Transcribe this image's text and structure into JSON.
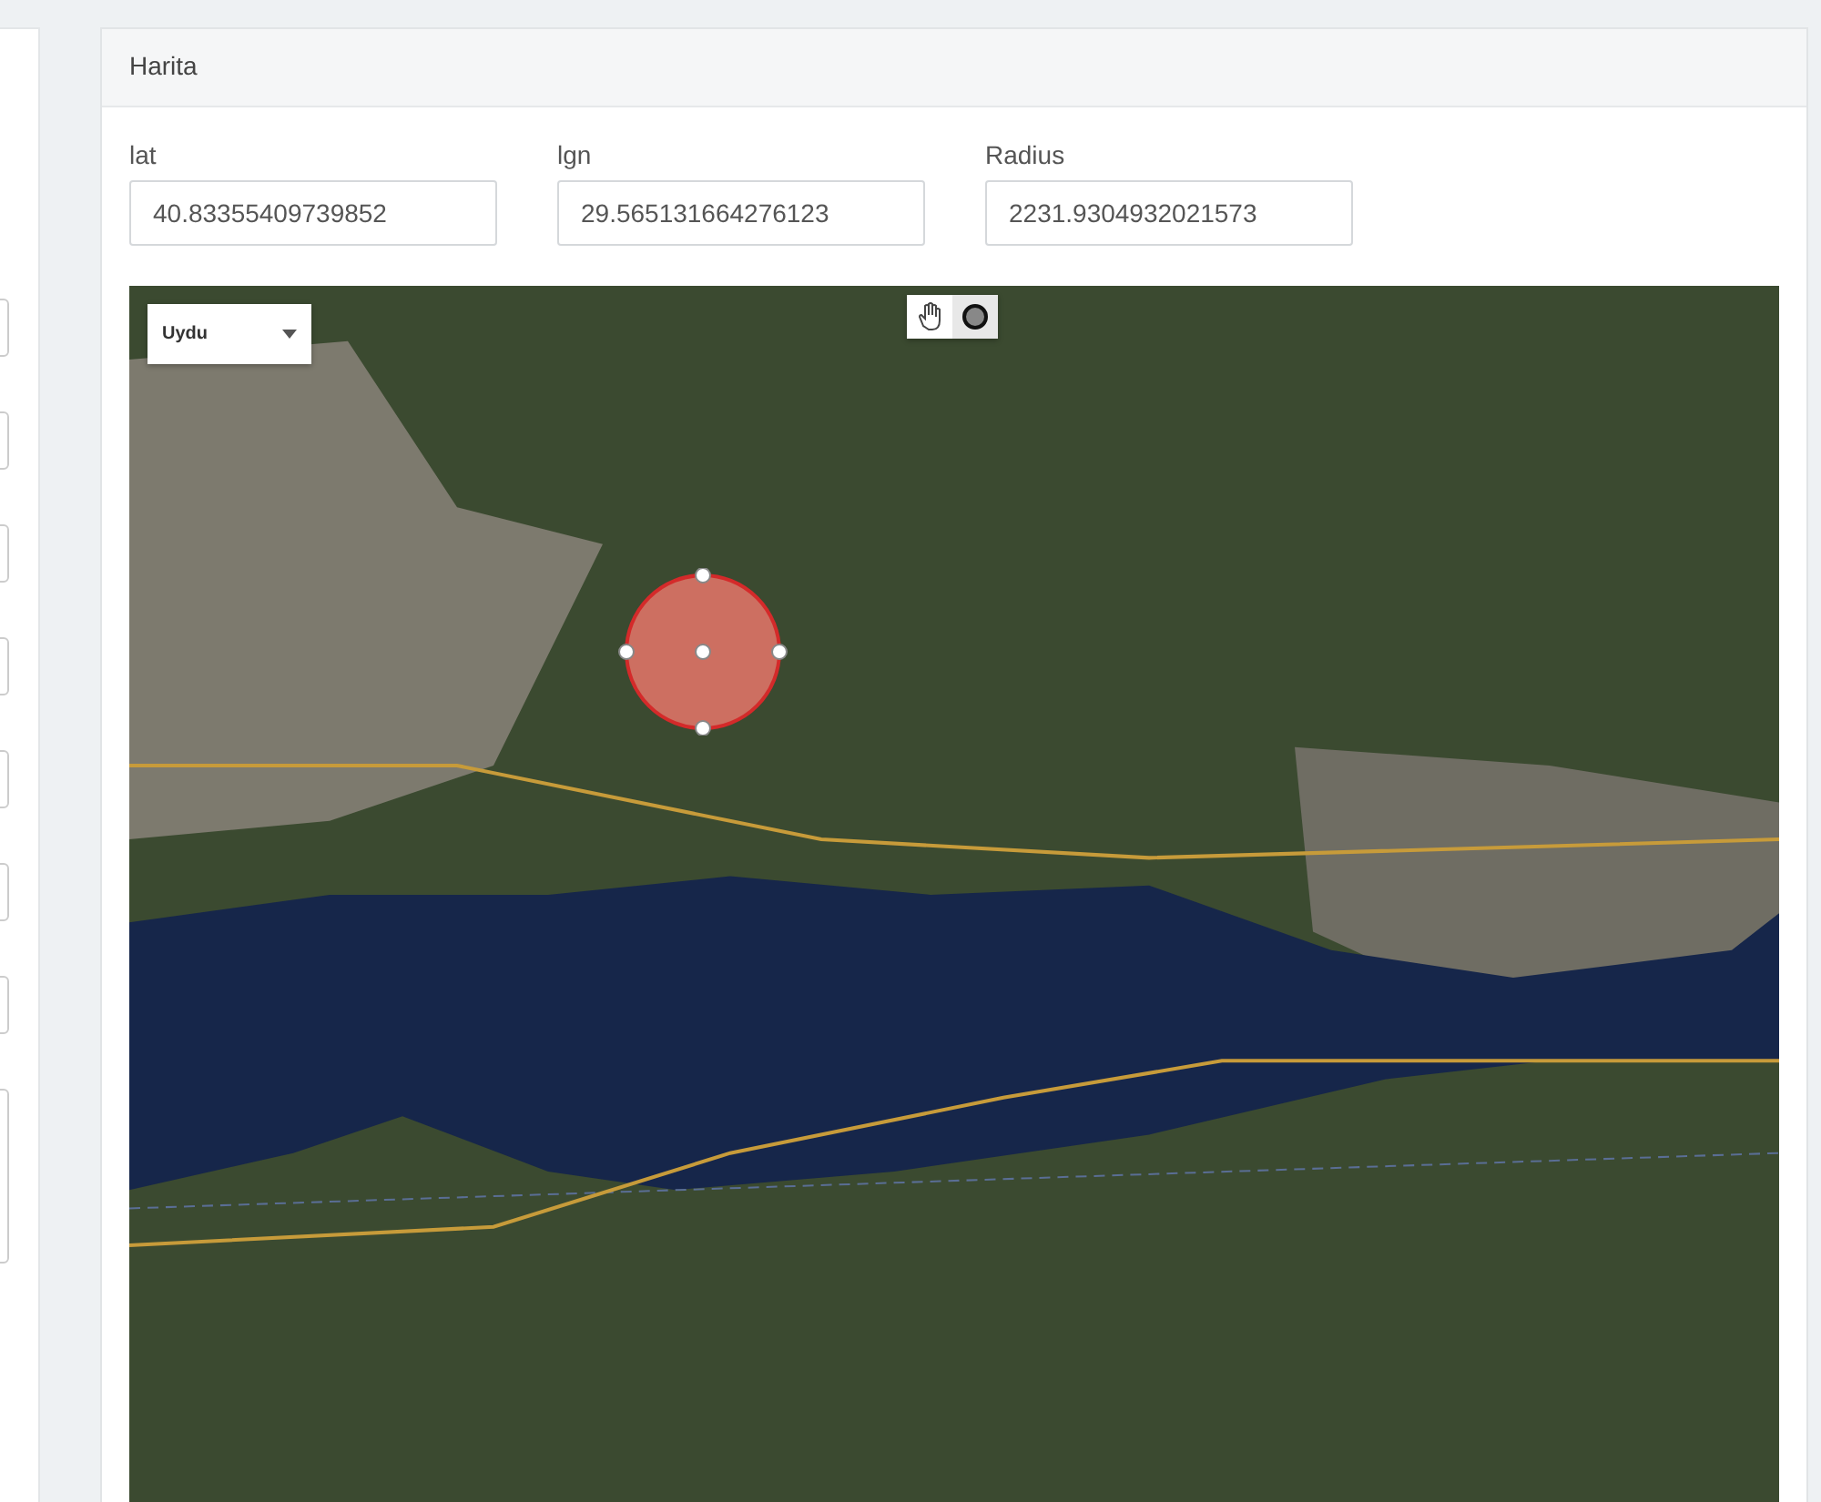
{
  "left_panel": {
    "fields": [
      {
        "kind": "input"
      },
      {
        "kind": "input"
      },
      {
        "kind": "input"
      },
      {
        "kind": "input"
      },
      {
        "kind": "input"
      },
      {
        "kind": "input"
      },
      {
        "kind": "input"
      },
      {
        "kind": "textarea"
      }
    ]
  },
  "card": {
    "title": "Harita",
    "fields": [
      {
        "label": "lat",
        "value": "40.83355409739852"
      },
      {
        "label": "lgn",
        "value": "29.565131664276123"
      },
      {
        "label": "Radius",
        "value": "2231.9304932021573"
      }
    ],
    "map": {
      "map_type": {
        "value": "Uydu"
      },
      "tools": [
        {
          "kind": "hand",
          "selected": false
        },
        {
          "kind": "circle",
          "selected": true
        }
      ]
    }
  }
}
